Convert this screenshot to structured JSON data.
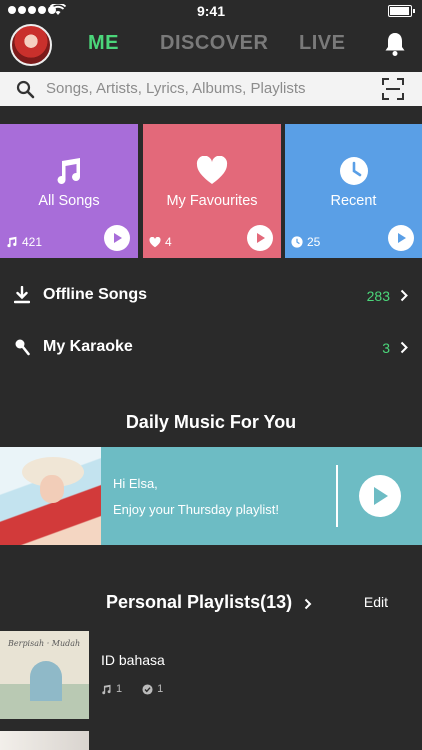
{
  "status": {
    "time": "9:41"
  },
  "nav": {
    "tabs": [
      "ME",
      "DISCOVER",
      "LIVE"
    ]
  },
  "search": {
    "placeholder": "Songs, Artists, Lyrics, Albums, Playlists"
  },
  "cards": [
    {
      "label": "All Songs",
      "count": "421",
      "icon": "music-note-icon",
      "count_icon": "music-note-icon",
      "color": "#a86dd9"
    },
    {
      "label": "My Favourites",
      "count": "4",
      "icon": "heart-icon",
      "count_icon": "heart-icon",
      "color": "#e3697a"
    },
    {
      "label": "Recent",
      "count": "25",
      "icon": "clock-icon",
      "count_icon": "clock-icon",
      "color": "#5a9fe6"
    }
  ],
  "library": [
    {
      "label": "Offline Songs",
      "count": "283",
      "icon": "download-icon"
    },
    {
      "label": "My Karaoke",
      "count": "3",
      "icon": "microphone-icon"
    }
  ],
  "daily": {
    "title": "Daily Music For You",
    "greeting": "Hi Elsa,",
    "subtitle": "Enjoy your Thursday playlist!",
    "color": "#6dbcc4"
  },
  "playlists": {
    "title": "Personal Playlists(13)",
    "edit": "Edit",
    "items": [
      {
        "name": "ID bahasa",
        "songs": "1",
        "downloads": "1"
      }
    ]
  },
  "colors": {
    "accent": "#4bd67a",
    "background": "#2a2a2a"
  }
}
